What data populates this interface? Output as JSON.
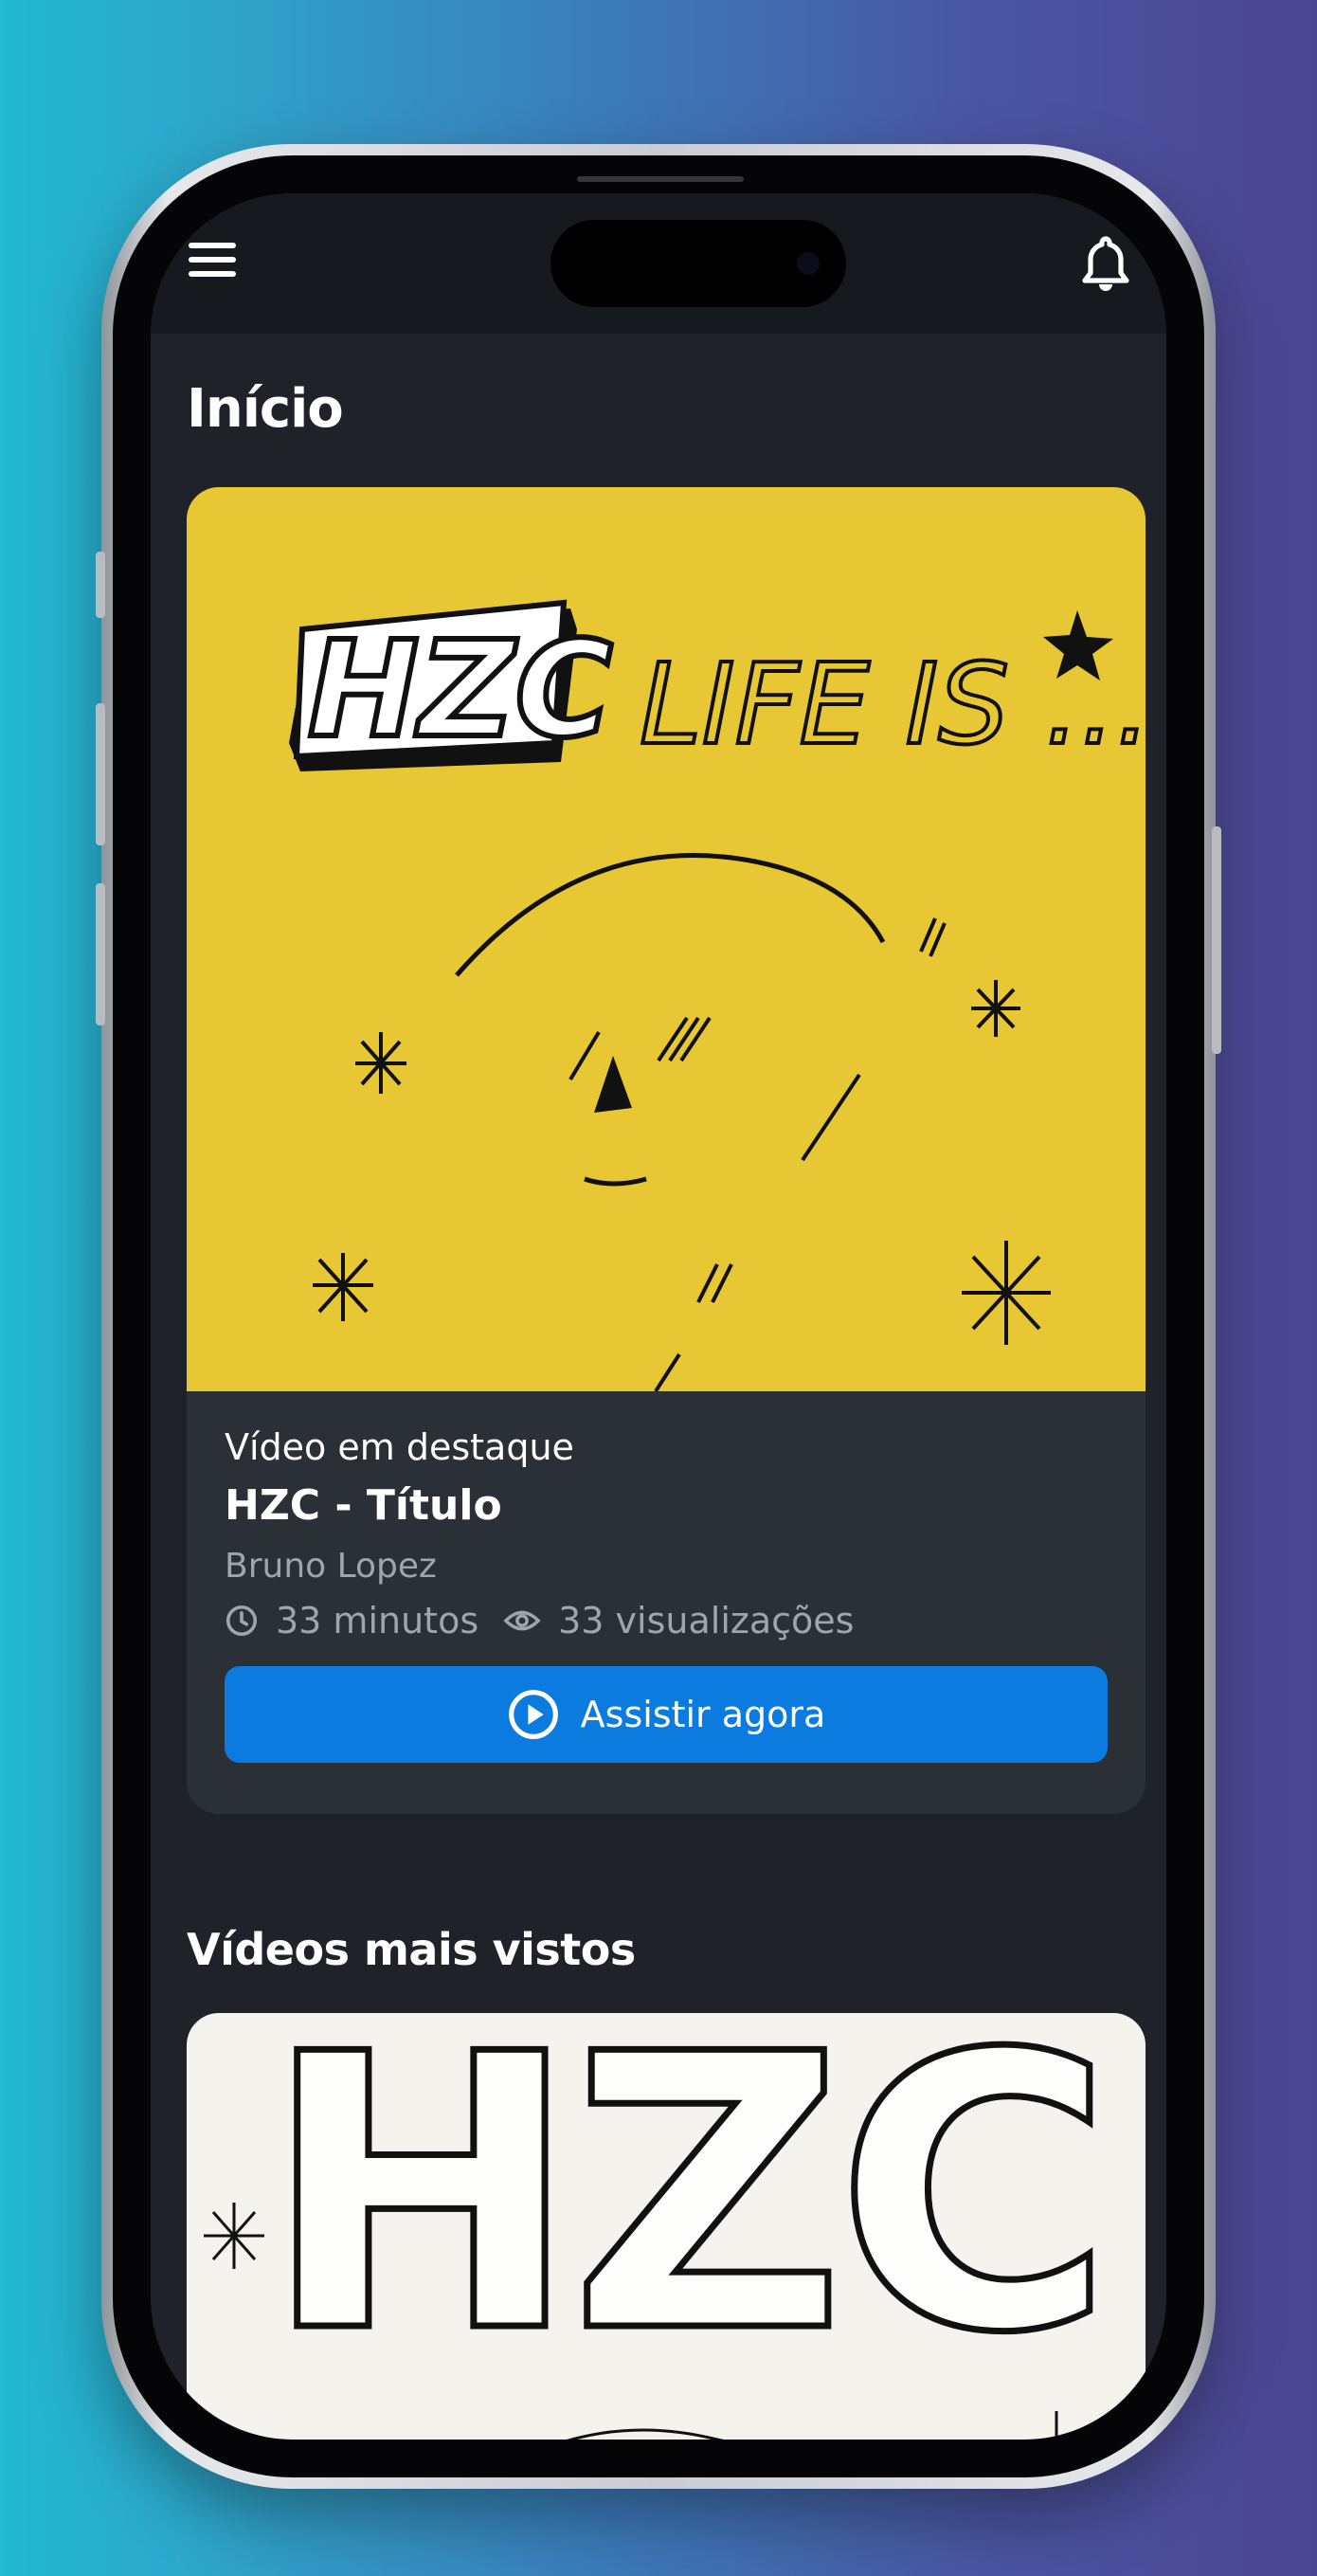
{
  "header": {
    "menu_icon": "hamburger-menu-icon",
    "notification_icon": "bell-icon"
  },
  "page": {
    "title": "Início"
  },
  "featured": {
    "eyebrow": "Vídeo em destaque",
    "title": "HZC - Título",
    "author": "Bruno Lopez",
    "duration": "33 minutos",
    "views": "33 visualizações",
    "thumbnail_text_logo": "HZC",
    "thumbnail_text": "LIFE IS ...",
    "watch_label": "Assistir agora",
    "colors": {
      "thumb_bg": "#e7c733",
      "button": "#0b7be0"
    }
  },
  "most_viewed": {
    "title": "Vídeos mais vistos",
    "first_thumbnail_text": "HZC"
  },
  "colors": {
    "screen_bg": "#1f2329",
    "card_bg": "#2b3037",
    "muted_text": "#9fa5ad"
  }
}
